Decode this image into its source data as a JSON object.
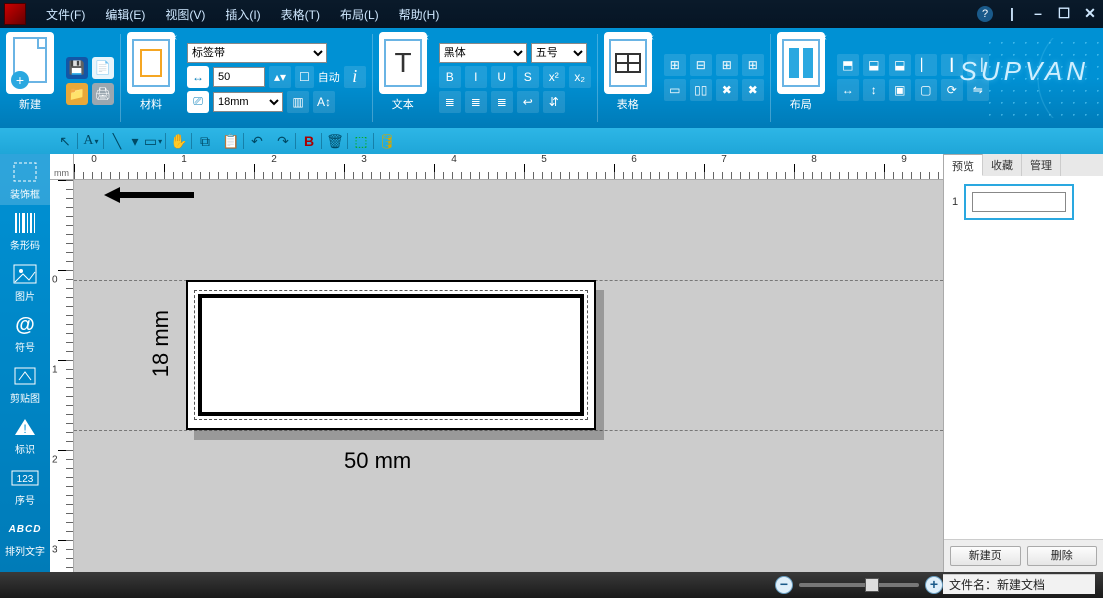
{
  "menus": {
    "file": "文件(F)",
    "edit": "编辑(E)",
    "view": "视图(V)",
    "insert": "插入(I)",
    "table": "表格(T)",
    "layout": "布局(L)",
    "help": "帮助(H)"
  },
  "titlebar": {
    "help_glyph": "?",
    "min": "–",
    "restore": "☐",
    "close": "✕",
    "extra": "|"
  },
  "ribbon": {
    "new_label": "新建",
    "material_label": "材料",
    "text_label": "文本",
    "table_label": "表格",
    "layout_label": "布局",
    "tape_type": "标签带",
    "width_value": "50",
    "auto_label": "自动",
    "height_value": "18mm",
    "font_name": "黑体",
    "font_size": "五号",
    "icons": {
      "save": "💾",
      "open": "📄",
      "folder": "📁",
      "print": "🖨",
      "length": "↔",
      "info": "i",
      "tape": "⎚",
      "bold": "B",
      "italic": "I",
      "underline": "U",
      "strike": "S",
      "align_l": "≣",
      "align_c": "≣",
      "align_r": "≣",
      "wrap": "↩",
      "super": "x²",
      "sub": "x₂",
      "barcode": "⎍",
      "grid": "▦"
    }
  },
  "brand": "SUPVAN",
  "toolstrip": {
    "pointer": "↖",
    "text": "A",
    "line": "╲",
    "rect": "▭",
    "hand": "✋",
    "copy": "⧉",
    "paste": "📋",
    "undo": "↶",
    "redo": "↷",
    "b": "B",
    "delete": "🗑",
    "group": "⬚",
    "db": "🛢"
  },
  "sidebar": {
    "frame": "装饰框",
    "barcode": "条形码",
    "image": "图片",
    "symbol": "符号",
    "clip": "剪贴图",
    "mark": "标识",
    "serial": "序号",
    "arrange": "排列文字",
    "icons": {
      "frame": "▭",
      "barcode": "▮▮▮",
      "image": "🖼",
      "symbol": "@",
      "clip": "✎",
      "mark": "▲",
      "serial": "123",
      "arrange": "ABCD"
    }
  },
  "ruler": {
    "unit": "mm",
    "h_numbers": [
      "0",
      "1",
      "2",
      "3",
      "4",
      "5",
      "6",
      "7",
      "8",
      "9"
    ],
    "v_numbers": [
      "0",
      "1",
      "2",
      "3"
    ]
  },
  "canvas": {
    "height_label": "18 mm",
    "width_label": "50 mm"
  },
  "rightpanel": {
    "tabs": {
      "preview": "预览",
      "favorite": "收藏",
      "manage": "管理"
    },
    "page_num": "1",
    "new_page": "新建页",
    "delete": "删除"
  },
  "status": {
    "filename_label": "文件名：",
    "filename": "新建文档",
    "zoom_minus": "−",
    "zoom_plus": "+"
  }
}
